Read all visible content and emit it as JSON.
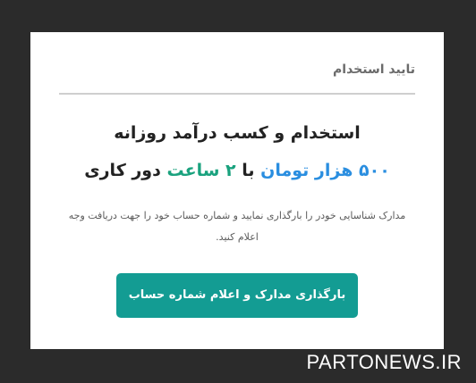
{
  "dialog": {
    "title": "تایید استخدام",
    "headline": "استخدام و کسب درآمد روزانه",
    "subline": {
      "amount": "۵۰۰ هزار تومان",
      "with": "با",
      "hours": "۲ ساعت",
      "remote": "دور کاری"
    },
    "description": "مدارک شناسایی خودر را بارگذاری نمایید و شماره حساب خود را جهت دریافت وجه اعلام کنید.",
    "button_label": "بارگذاری مدارک و اعلام شماره حساب"
  },
  "watermark": "PARTONEWS.IR",
  "colors": {
    "amount": "#2a8ee0",
    "hours": "#1aa27e",
    "button": "#139c93",
    "background": "#2b2b2b"
  }
}
